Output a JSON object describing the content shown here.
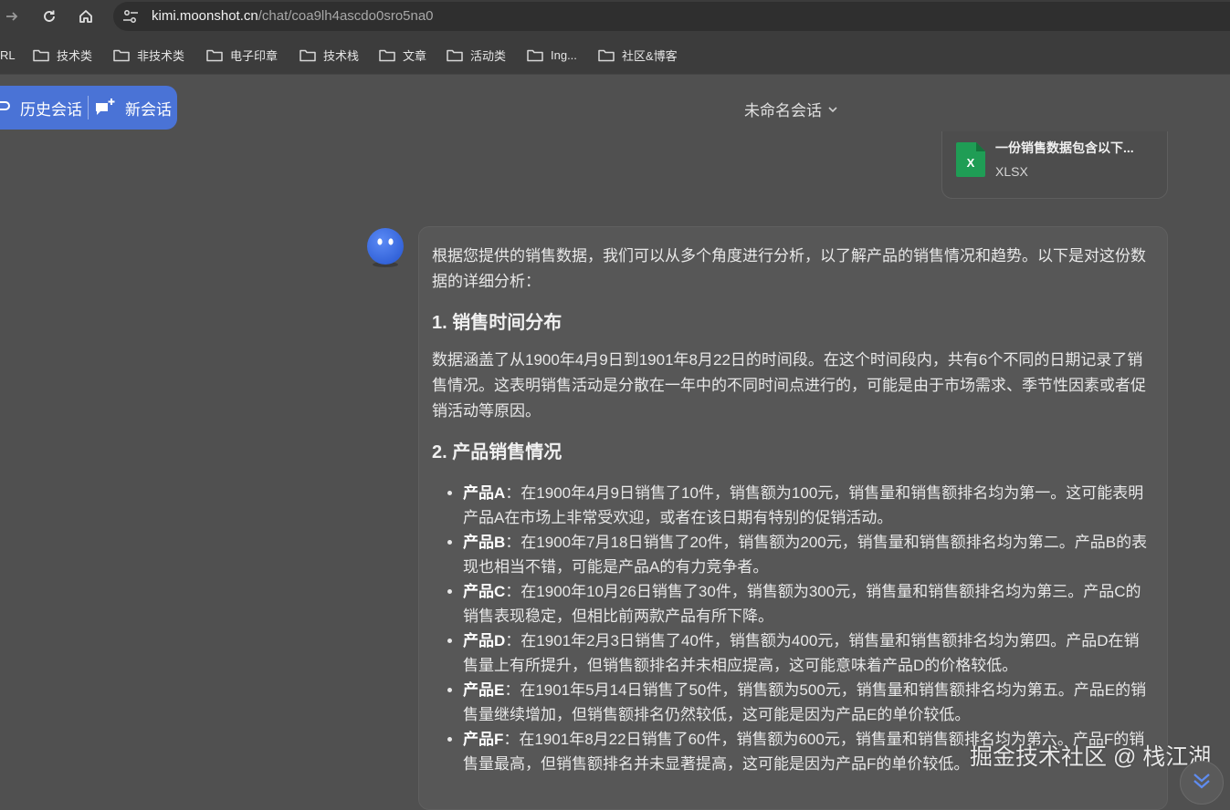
{
  "browser": {
    "url_host": "kimi.moonshot.cn",
    "url_path": "/chat/coa9lh4ascdo0sro5na0"
  },
  "bookmarks": [
    {
      "label": "RL"
    },
    {
      "label": "技术类"
    },
    {
      "label": "非技术类"
    },
    {
      "label": "电子印章"
    },
    {
      "label": "技术栈"
    },
    {
      "label": "文章"
    },
    {
      "label": "活动类"
    },
    {
      "label": "Ing..."
    },
    {
      "label": "社区&博客"
    }
  ],
  "sidebar": {
    "history_label": "历史会话",
    "new_chat_label": "新会话"
  },
  "conversation": {
    "title": "未命名会话"
  },
  "attachment": {
    "name": "一份销售数据包含以下...",
    "type": "XLSX",
    "icon_letter": "X"
  },
  "answer": {
    "intro": "根据您提供的销售数据，我们可以从多个角度进行分析，以了解产品的销售情况和趋势。以下是对这份数据的详细分析：",
    "section1_title": "1. 销售时间分布",
    "section1_body": "数据涵盖了从1900年4月9日到1901年8月22日的时间段。在这个时间段内，共有6个不同的日期记录了销售情况。这表明销售活动是分散在一年中的不同时间点进行的，可能是由于市场需求、季节性因素或者促销活动等原因。",
    "section2_title": "2. 产品销售情况",
    "items": [
      {
        "name": "产品A",
        "text": "：在1900年4月9日销售了10件，销售额为100元，销售量和销售额排名均为第一。这可能表明产品A在市场上非常受欢迎，或者在该日期有特别的促销活动。"
      },
      {
        "name": "产品B",
        "text": "：在1900年7月18日销售了20件，销售额为200元，销售量和销售额排名均为第二。产品B的表现也相当不错，可能是产品A的有力竞争者。"
      },
      {
        "name": "产品C",
        "text": "：在1900年10月26日销售了30件，销售额为300元，销售量和销售额排名均为第三。产品C的销售表现稳定，但相比前两款产品有所下降。"
      },
      {
        "name": "产品D",
        "text": "：在1901年2月3日销售了40件，销售额为400元，销售量和销售额排名均为第四。产品D在销售量上有所提升，但销售额排名并未相应提高，这可能意味着产品D的价格较低。"
      },
      {
        "name": "产品E",
        "text": "：在1901年5月14日销售了50件，销售额为500元，销售量和销售额排名均为第五。产品E的销售量继续增加，但销售额排名仍然较低，这可能是因为产品E的单价较低。"
      },
      {
        "name": "产品F",
        "text": "：在1901年8月22日销售了60件，销售额为600元，销售量和销售额排名均为第六。产品F的销售量最高，但销售额排名并未显著提高，这可能是因为产品F的单价较低。"
      }
    ]
  },
  "watermark": "掘金技术社区 @ 栈江湖",
  "colors": {
    "accent": "#4a73d6",
    "excel_green": "#1f9d55",
    "avatar_blue": "#3d6fe0"
  }
}
